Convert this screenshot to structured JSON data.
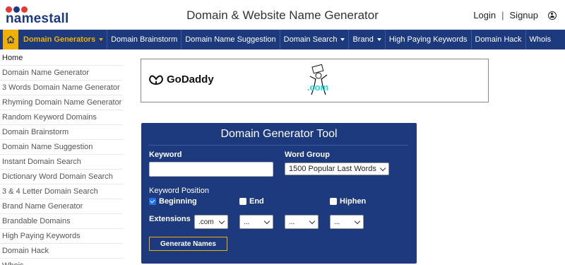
{
  "header": {
    "logo_text": "namestall",
    "logo_dot_colors": [
      "#e53935",
      "#1d3a7e",
      "#e53935"
    ],
    "site_title": "Domain & Website Name Generator",
    "login": "Login",
    "separator": "|",
    "signup": "Signup",
    "user_icon": "user-circle-icon"
  },
  "navbar": {
    "home_icon": "home-icon",
    "items": [
      {
        "label": "Domain Generators",
        "dropdown": true,
        "active": true
      },
      {
        "label": "Domain Brainstorm"
      },
      {
        "label": "Domain Name Suggestion"
      },
      {
        "label": "Domain Search",
        "dropdown": true
      },
      {
        "label": "Brand",
        "dropdown": true
      },
      {
        "label": "High Paying Keywords"
      },
      {
        "label": "Domain Hack"
      },
      {
        "label": "Whois"
      }
    ]
  },
  "sidebar": {
    "items": [
      "Home",
      "Domain Name Generator",
      "3 Words Domain Name Generator",
      "Rhyming Domain Name Generator",
      "Random Keyword Domains",
      "Domain Brainstorm",
      "Domain Name Suggestion",
      "Instant Domain Search",
      "Dictionary Word Domain Search",
      "3 & 4 Letter Domain Search",
      "Brand Name Generator",
      "Brandable Domains",
      "High Paying Keywords",
      "Domain Hack",
      "Whois"
    ]
  },
  "ad": {
    "brand": "GoDaddy",
    "art_text": ".com"
  },
  "tool": {
    "title": "Domain Generator Tool",
    "keyword_label": "Keyword",
    "keyword_value": "",
    "word_group_label": "Word Group",
    "word_group_value": "1500 Popular Last Words",
    "position_label": "Keyword Position",
    "positions": [
      {
        "label": "Beginning",
        "checked": true
      },
      {
        "label": "End",
        "checked": false
      },
      {
        "label": "Hiphen",
        "checked": false
      }
    ],
    "extensions_label": "Extensions",
    "extensions": [
      ".com",
      "...",
      "...",
      "..."
    ],
    "generate_label": "Generate Names"
  },
  "colors": {
    "brand_blue": "#1d3a7e",
    "accent_yellow": "#f0b000",
    "checkbox_blue": "#1e73e8"
  }
}
